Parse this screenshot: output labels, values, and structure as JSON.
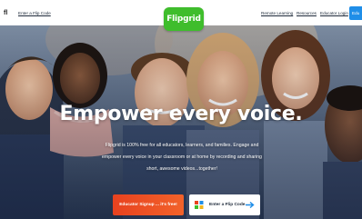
{
  "header": {
    "logo_glyph": "fl",
    "enter_code_link": "Enter a Flip Code",
    "brand": "Flipgrid",
    "nav": {
      "remote_learning": "Remote Learning",
      "resources": "Resources",
      "educator_login": "Educator Login",
      "cta": "Edu"
    }
  },
  "hero": {
    "headline": "Empower every voice.",
    "subtext": "Flipgrid is 100% free for all educators, learners, and families. Engage and empower every voice in your classroom or at home by recording and sharing short, awesome videos...together!",
    "signup_button": "Educator Signup ... it's free!",
    "code_button": "Enter a Flip Code"
  },
  "colors": {
    "brand_green": "#3fbd2c",
    "signup_orange": "#e8421f",
    "nav_blue": "#1f8ee8"
  },
  "icons": {
    "code_icon": "grid-icon",
    "arrow_icon": "arrow-right-icon"
  }
}
